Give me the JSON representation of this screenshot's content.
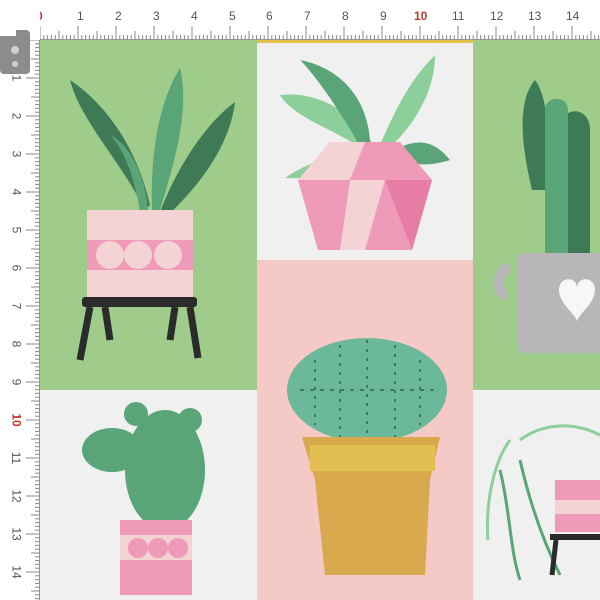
{
  "ruler_top": {
    "labels": [
      "0",
      "1",
      "2",
      "3",
      "4",
      "5",
      "6",
      "7",
      "8",
      "9",
      "10",
      "11",
      "12",
      "13",
      "14"
    ],
    "highlight": [
      "0",
      "10"
    ]
  },
  "ruler_left": {
    "labels": [
      "1",
      "2",
      "3",
      "4",
      "5",
      "6",
      "7",
      "8",
      "9",
      "10",
      "11",
      "12",
      "13",
      "14"
    ],
    "highlight": [
      "10"
    ]
  },
  "colors": {
    "green_bg": "#9fcc8a",
    "pink_bg": "#f4c9c6",
    "white_bg": "#f1f0f1",
    "pot_pink": "#ee9ab8",
    "pot_light": "#f3d3d3",
    "leaf_dark": "#3f7a56",
    "leaf_mid": "#5aa578",
    "leaf_light": "#8ccf9a",
    "mustard": "#d8a94d",
    "grey_pot": "#b8b6b8",
    "stand_black": "#2b2b2b",
    "ruler_red": "#c0392b"
  },
  "plants": [
    "snake-plant-in-pink-pot-on-stand",
    "leafy-plant-in-pink-gem-pot",
    "cactus-in-grey-heart-mug",
    "prickly-pear-cactus-in-pink-pot",
    "round-cactus-in-mustard-pot",
    "string-of-pearls-in-pink-pot"
  ]
}
